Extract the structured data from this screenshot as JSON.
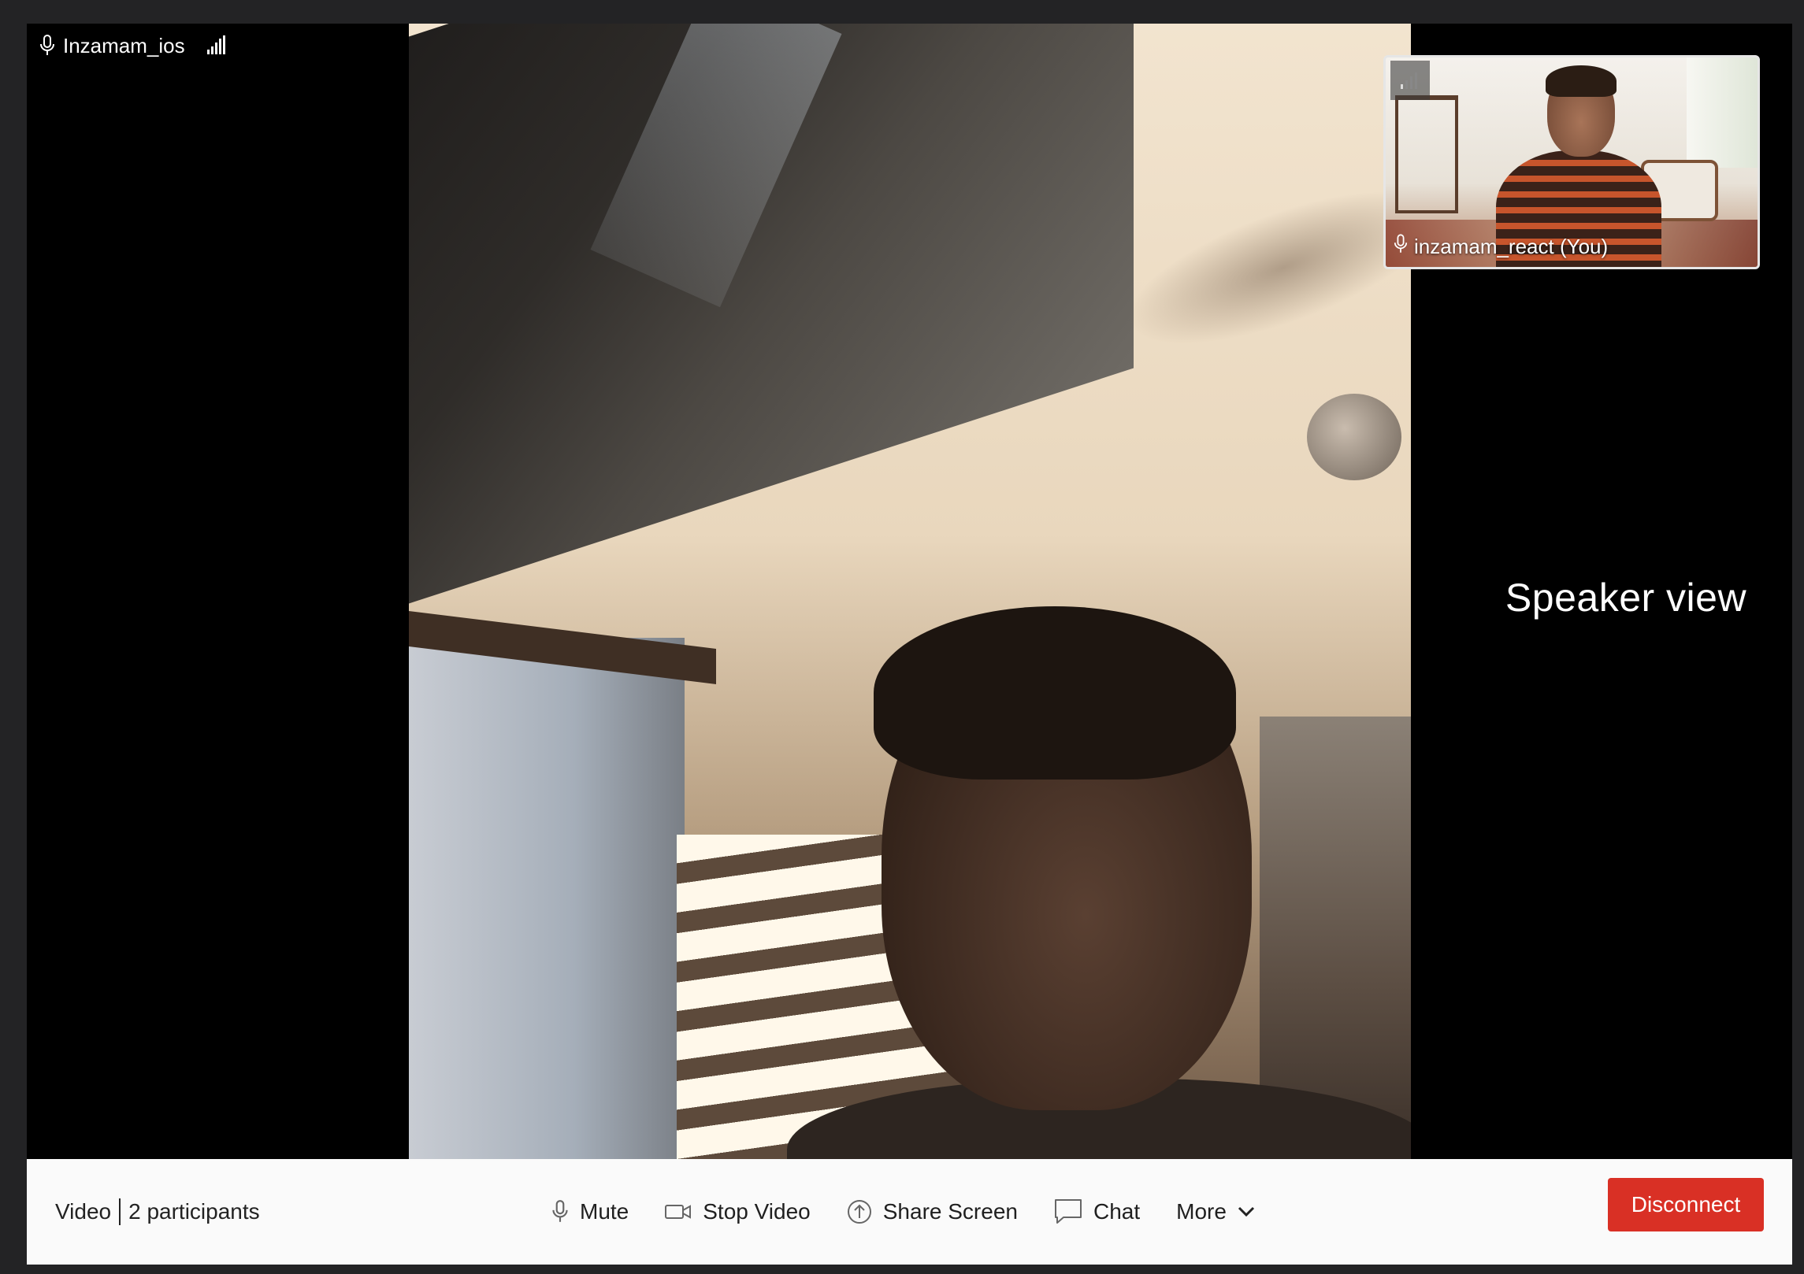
{
  "main_participant": {
    "name": "Inzamam_ios",
    "icons": [
      "microphone-icon",
      "network-signal-icon"
    ]
  },
  "view_mode_label": "Speaker view",
  "self_preview": {
    "name": "inzamam_react (You)",
    "icons": [
      "microphone-icon",
      "network-signal-icon"
    ]
  },
  "toolbar": {
    "room_type": "Video",
    "participants": "2 participants",
    "buttons": {
      "mute": "Mute",
      "stop_video": "Stop Video",
      "share_screen": "Share Screen",
      "chat": "Chat",
      "more": "More",
      "disconnect": "Disconnect"
    }
  },
  "colors": {
    "disconnect_bg": "#d93025",
    "toolbar_bg": "#fafafa",
    "window_frame": "#232325"
  }
}
